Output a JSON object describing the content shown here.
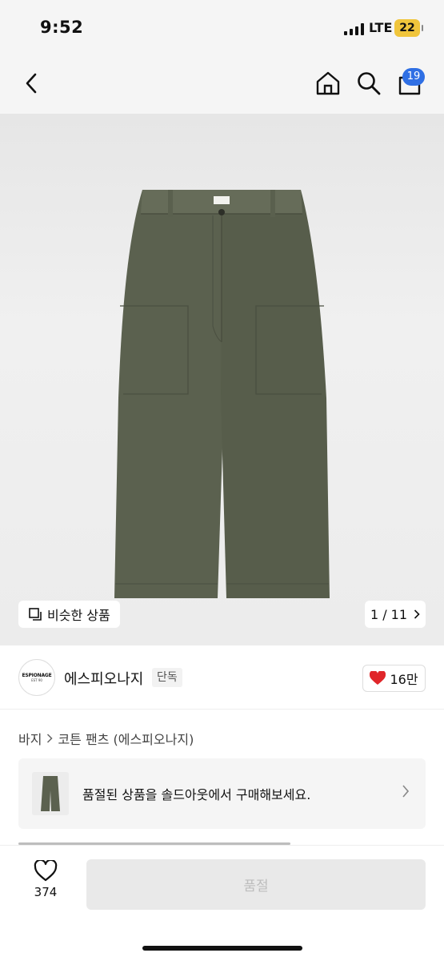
{
  "status": {
    "time": "9:52",
    "network": "LTE",
    "battery": "22"
  },
  "nav": {
    "back_icon": "chevron-left-icon",
    "home_icon": "home-icon",
    "search_icon": "search-icon",
    "cart_icon": "cart-icon",
    "cart_count": "19"
  },
  "hero": {
    "similar_label": "비슷한 상품",
    "similar_icon": "copy-icon",
    "pager": "1 / 11"
  },
  "brand": {
    "logo_line1": "ESPIONAGE",
    "logo_line2": "EST 90",
    "name": "에스피오나지",
    "tag": "단독",
    "likes": "16만"
  },
  "breadcrumb": {
    "category": "바지",
    "product": "코튼 팬츠 (에스피오나지)"
  },
  "banner": {
    "text": "품절된 상품을 솔드아웃에서 구매해보세요."
  },
  "bottom": {
    "wish_count": "374",
    "button_label": "품절"
  },
  "colors": {
    "accent_blue": "#2f6fe4",
    "like_red": "#e0262a",
    "battery": "#f0c53c",
    "pants_olive": "#5b614f"
  }
}
